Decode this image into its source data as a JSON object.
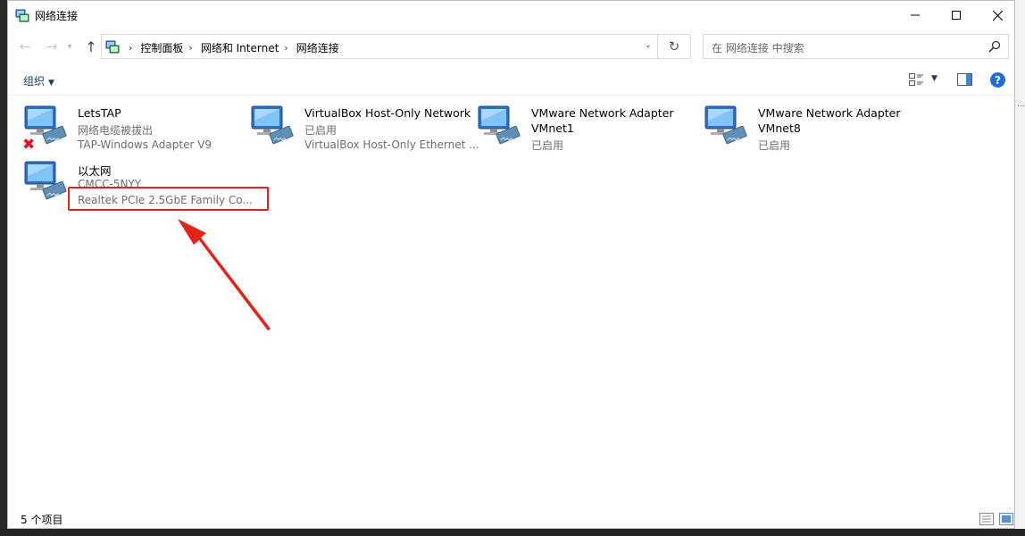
{
  "window": {
    "title": "网络连接",
    "controls": {
      "minimize": "minimize",
      "maximize": "maximize",
      "close": "close"
    }
  },
  "address_bar": {
    "breadcrumbs": [
      "控制面板",
      "网络和 Internet",
      "网络连接"
    ]
  },
  "search": {
    "placeholder": "在 网络连接 中搜索"
  },
  "toolbar": {
    "organize_label": "组织"
  },
  "connections": [
    {
      "name": "LetsTAP",
      "status": "网络电缆被拔出",
      "device": "TAP-Windows Adapter V9",
      "disconnected": true
    },
    {
      "name": "VirtualBox Host-Only Network",
      "status": "已启用",
      "device": "VirtualBox Host-Only Ethernet ..."
    },
    {
      "name": "VMware Network Adapter",
      "name2": "VMnet1",
      "status": "已启用"
    },
    {
      "name": "VMware Network Adapter",
      "name2": "VMnet8",
      "status": "已启用"
    },
    {
      "name": "以太网",
      "status": "CMCC-5NYY",
      "device": "Realtek PCIe 2.5GbE Family Co..."
    }
  ],
  "annotation": {
    "color": "#e2231a"
  },
  "status_bar": {
    "item_count": "5 个项目"
  },
  "icons": {
    "title": "network-connections-icon",
    "adapter": "network-adapter-icon",
    "disconnected": "disconnected-x-icon"
  }
}
